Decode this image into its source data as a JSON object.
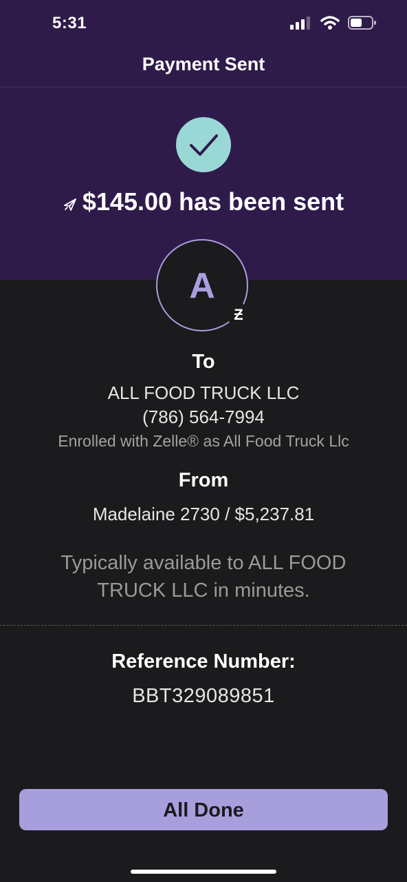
{
  "status_bar": {
    "time": "5:31",
    "icons": [
      "cellular-signal-icon",
      "wifi-icon",
      "battery-icon"
    ]
  },
  "nav": {
    "title": "Payment Sent"
  },
  "confirmation": {
    "icon": "checkmark-icon",
    "amount_text": "$145.00 has been sent",
    "send_icon": "paper-plane-icon"
  },
  "recipient": {
    "avatar_letter": "A",
    "badge_symbol": "Ƶ",
    "to_label": "To",
    "name": "ALL FOOD TRUCK LLC",
    "phone": "(786) 564-7994",
    "enrolled_text": "Enrolled with Zelle® as All Food Truck Llc"
  },
  "sender": {
    "from_label": "From",
    "account": "Madelaine 2730 / $5,237.81"
  },
  "availability": {
    "line1": "Typically available to ALL FOOD",
    "line2": "TRUCK LLC in minutes."
  },
  "reference": {
    "label": "Reference Number:",
    "number": "BBT329089851"
  },
  "actions": {
    "done_label": "All Done"
  },
  "colors": {
    "header_bg": "#2e1b4a",
    "body_bg": "#1b1a1c",
    "accent": "#a79fdc",
    "check_bg": "#9ad8d6"
  }
}
